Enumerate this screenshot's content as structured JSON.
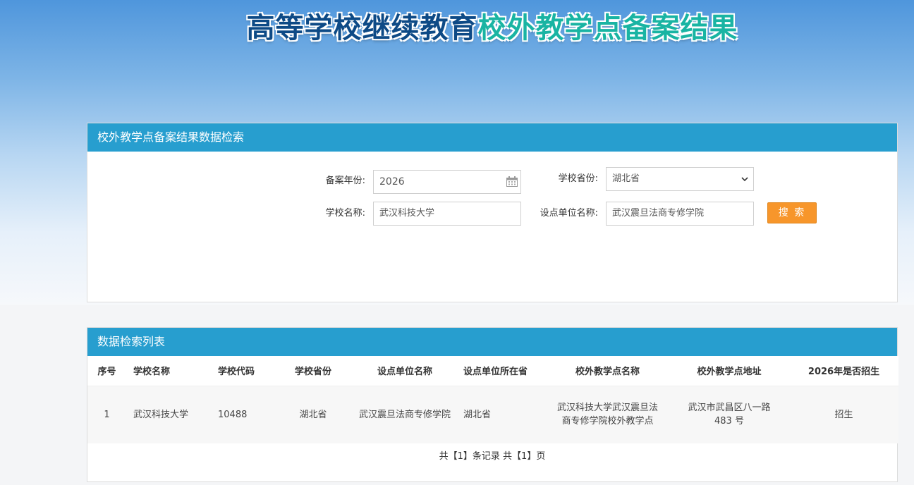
{
  "banner": {
    "title_part1": "高等学校继续教育",
    "title_part2": "校外教学点备案结果"
  },
  "search": {
    "heading": "校外教学点备案结果数据检索",
    "year_label": "备案年份:",
    "year_value": "2026",
    "province_label": "学校省份:",
    "province_value": "湖北省",
    "school_label": "学校名称:",
    "school_value": "武汉科技大学",
    "unit_label": "设点单位名称:",
    "unit_value": "武汉震旦法商专修学院",
    "search_button": "搜 索"
  },
  "results": {
    "heading": "数据检索列表",
    "columns": [
      "序号",
      "学校名称",
      "学校代码",
      "学校省份",
      "设点单位名称",
      "设点单位所在省",
      "校外教学点名称",
      "校外教学点地址",
      "2026年是否招生"
    ],
    "rows": [
      [
        "1",
        "武汉科技大学",
        "10488",
        "湖北省",
        "武汉震旦法商专修学院",
        "湖北省",
        "武汉科技大学武汉震旦法商专修学院校外教学点",
        "武汉市武昌区八一路 483 号",
        "招生"
      ]
    ],
    "pager": "共【1】条记录 共【1】页"
  },
  "colors": {
    "header_blue": "#279ecf",
    "button_orange": "#f7962b",
    "title_navy": "#0d4a86",
    "title_teal": "#19b4a3"
  }
}
